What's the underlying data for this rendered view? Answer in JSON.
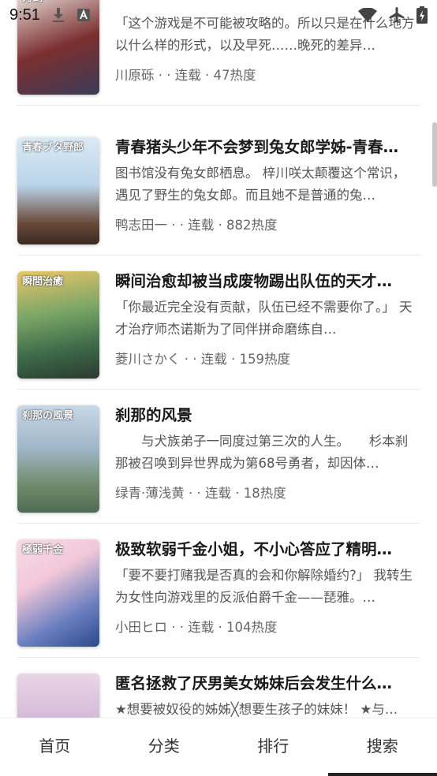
{
  "status_bar": {
    "time": "9:51",
    "icons": [
      "download-icon",
      "text-a-icon",
      "wifi-icon",
      "airplane-icon",
      "battery-charging-icon"
    ]
  },
  "books": [
    {
      "title": "",
      "desc": "「这个游戏是不可能被攻略的。所以只是在什么地方以什么样的形式，以及早死……晚死的差异…",
      "meta": "川原砾 · · 连载 · 47热度",
      "cover_colors": [
        "#7b2f2f",
        "#3b3b58"
      ],
      "cover_text": "刀剑"
    },
    {
      "title": "青春猪头少年不会梦到兔女郎学姊-青春…",
      "desc": "图书馆没有兔女郎栖息。 梓川咲太颠覆这个常识，遇见了野生的兔女郎。而且她不是普通的兔…",
      "meta": "鸭志田一 · · 连载 · 882热度",
      "cover_colors": [
        "#cfe3f2",
        "#6a4a3a"
      ],
      "cover_text": "青春ブタ野郎"
    },
    {
      "title": "瞬间治愈却被当成废物踢出队伍的天才…",
      "desc": "「你最近完全没有贡献，队伍已经不需要你了。」 天才治疗师杰诺斯为了同伴拼命磨练自…",
      "meta": "菱川さかく · · 连载 · 159热度",
      "cover_colors": [
        "#3f6d4a",
        "#d9b45a"
      ],
      "cover_text": "瞬間治癒"
    },
    {
      "title": "刹那的风景",
      "desc": "　　与犬族弟子一同度过第三次的人生。　　杉本刹那被召唤到异世界成为第68号勇者，却因体…",
      "meta": "绿青·薄浅黄 · · 连载 · 18热度",
      "cover_colors": [
        "#9fb6c8",
        "#4f6a55"
      ],
      "cover_text": "刹那の風景"
    },
    {
      "title": "极致软弱千金小姐，不小心答应了精明…",
      "desc": "「要不要打赌我是否真的会和你解除婚约?」 我转生为女性向游戏里的反派伯爵千金——琵雅。…",
      "meta": "小田ヒロ · · 连载 · 104热度",
      "cover_colors": [
        "#f2c8d8",
        "#2a4a8a"
      ],
      "cover_text": "極弱千金"
    },
    {
      "title": "匿名拯救了厌男美女姊妹后会发生什么…",
      "desc": "★想要被奴役的姊姊╳想要生孩子的妹妹！ ★与…",
      "meta": "",
      "cover_colors": [
        "#e9d6e6",
        "#5a3a6a"
      ],
      "cover_text": ""
    }
  ],
  "bottom_nav": {
    "items": [
      "首页",
      "分类",
      "排行",
      "搜索"
    ],
    "active": "搜索"
  }
}
